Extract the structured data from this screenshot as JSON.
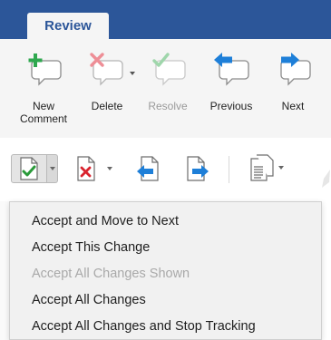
{
  "ribbon": {
    "active_tab": "Review",
    "buttons": [
      {
        "label": "New\nComment",
        "icon": "new-comment-icon",
        "enabled": true
      },
      {
        "label": "Delete",
        "icon": "delete-comment-icon",
        "enabled": true
      },
      {
        "label": "Resolve",
        "icon": "resolve-comment-icon",
        "enabled": false
      },
      {
        "label": "Previous",
        "icon": "previous-comment-icon",
        "enabled": true
      },
      {
        "label": "Next",
        "icon": "next-comment-icon",
        "enabled": true
      }
    ]
  },
  "toolbar": {
    "tools": [
      {
        "name": "accept-change",
        "icon": "accept-change-icon"
      },
      {
        "name": "reject-change",
        "icon": "reject-change-icon"
      },
      {
        "name": "previous-change",
        "icon": "previous-change-icon"
      },
      {
        "name": "next-change",
        "icon": "next-change-icon"
      },
      {
        "name": "reviewing-pane",
        "icon": "reviewing-pane-icon"
      }
    ]
  },
  "accept_menu": {
    "items": [
      {
        "label": "Accept and Move to Next",
        "enabled": true
      },
      {
        "label": "Accept This Change",
        "enabled": true
      },
      {
        "label": "Accept All Changes Shown",
        "enabled": false
      },
      {
        "label": "Accept All Changes",
        "enabled": true
      },
      {
        "label": "Accept All Changes and Stop Tracking",
        "enabled": true
      }
    ]
  },
  "colors": {
    "ribbon_blue": "#2c5699",
    "add_green": "#2fa84f",
    "delete_red": "#e04a55",
    "arrow_blue": "#1e7fd8",
    "check_green": "#2a9a3a",
    "x_red": "#d9232e"
  }
}
